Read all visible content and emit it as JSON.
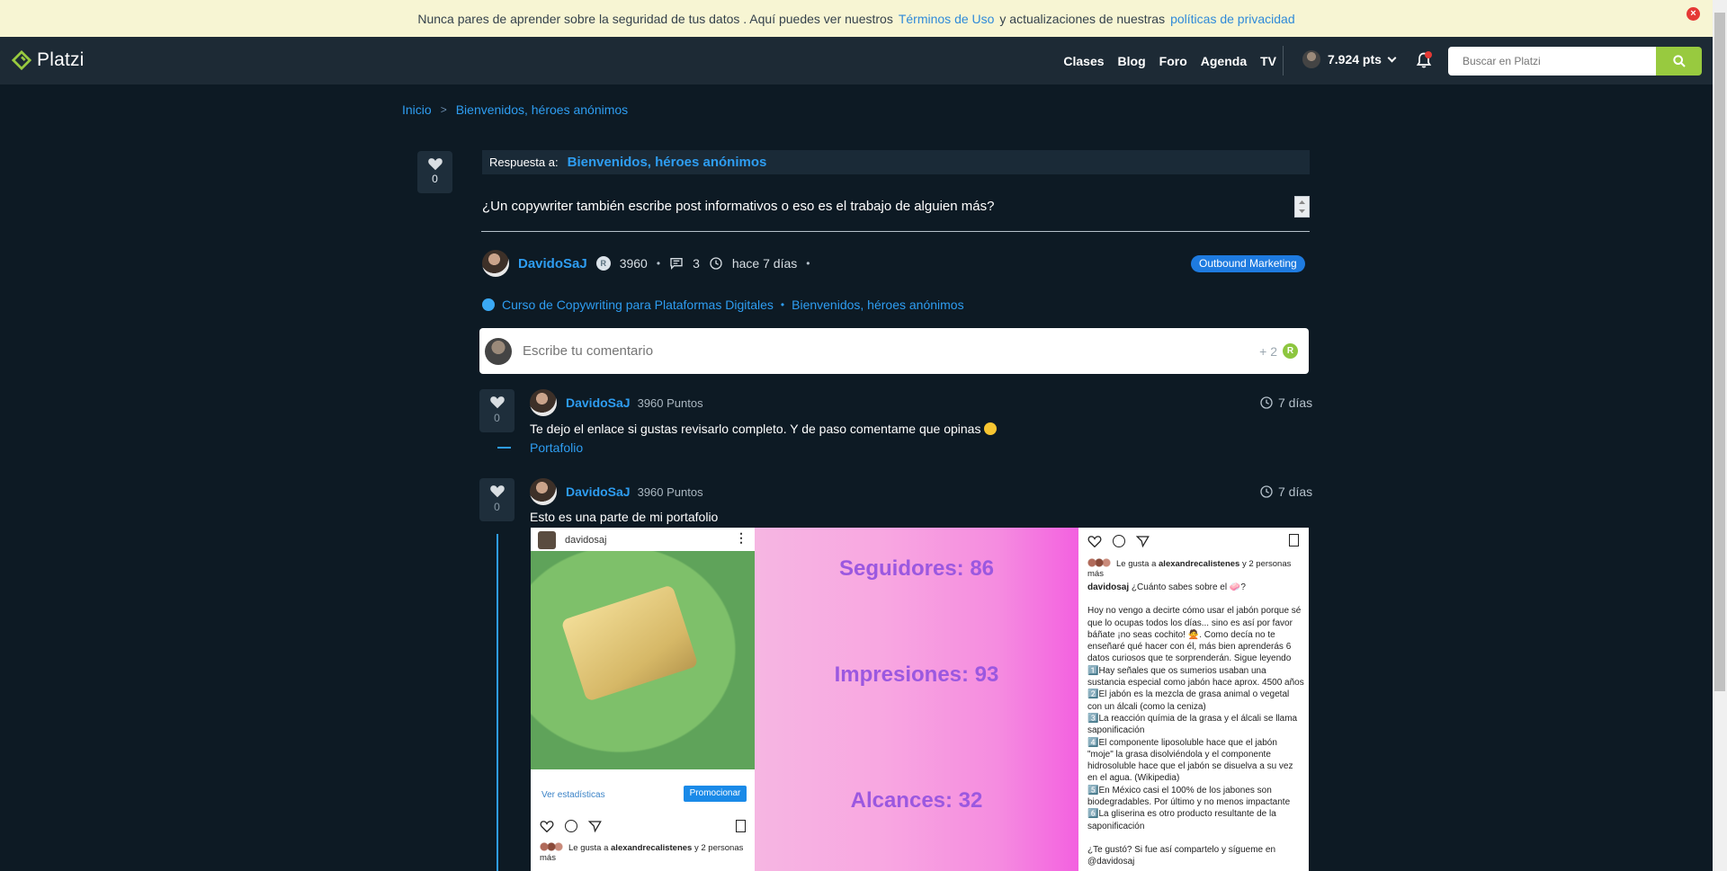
{
  "banner": {
    "text_before": "Nunca pares de aprender sobre la seguridad de tus datos . Aquí puedes ver nuestros",
    "terms_link": "Términos de Uso",
    "text_middle": "y actualizaciones de nuestras",
    "privacy_link": "políticas de privacidad",
    "close_glyph": "×"
  },
  "header": {
    "logo": "Platzi",
    "nav": [
      "Clases",
      "Blog",
      "Foro",
      "Agenda",
      "TV"
    ],
    "points": "7.924 pts",
    "search_placeholder": "Buscar en Platzi",
    "accent_color": "#98ca3f",
    "icons": [
      "bell-icon",
      "search-icon",
      "chevron-down-icon"
    ]
  },
  "breadcrumb": {
    "home": "Inicio",
    "separator": ">",
    "current": "Bienvenidos, héroes anónimos"
  },
  "question": {
    "likes": "0",
    "reply_prefix": "Respuesta a:",
    "reply_target": "Bienvenidos, héroes anónimos",
    "text": "¿Un copywriter también escribe post informativos o eso es el trabajo de alguien más?",
    "author": "DavidoSaJ",
    "rank_badge": "R",
    "author_points": "3960",
    "comments": "3",
    "time": "hace 7 días",
    "tag": "Outbound Marketing",
    "course": "Curso de Copywriting para Plataformas Digitales",
    "course_section": "Bienvenidos, héroes anónimos",
    "separator": "•"
  },
  "comment_box": {
    "placeholder": "Escribe tu comentario",
    "points_reward": "+ 2",
    "points_badge": "R"
  },
  "answers": [
    {
      "likes": "0",
      "author": "DavidoSaJ",
      "points": "3960 Puntos",
      "time": "7 días",
      "text": "Te dejo el enlace si gustas revisarlo completo. Y de paso comentame que opinas",
      "link": "Portafolio"
    },
    {
      "likes": "0",
      "author": "DavidoSaJ",
      "points": "3960 Puntos",
      "time": "7 días",
      "text": "Esto es una parte de mi portafolio"
    }
  ],
  "portfolio_image": {
    "left": {
      "username": "davidosaj",
      "more": "⋮",
      "stats_link": "Ver estadísticas",
      "promote": "Promocionar",
      "likes_prefix": "Le gusta a",
      "likes_user": "alexandrecalistenes",
      "likes_suffix": "y 2 personas más"
    },
    "middle": {
      "followers": "Seguidores: 86",
      "impressions": "Impresiones: 93",
      "reach": "Alcances: 32"
    },
    "right": {
      "likes_prefix": "Le gusta a",
      "likes_user": "alexandrecalistenes",
      "likes_suffix": "y 2 personas más",
      "caption_user": "davidosaj",
      "caption_lines": [
        "¿Cuánto sabes sobre el 🧼?",
        "",
        "Hoy no vengo a decirte cómo usar el jabón porque sé que lo ocupas todos los días... sino es así por favor báñate ¡no seas cochito! 🙅. Como decía no te enseñaré qué hacer con él, más bien aprenderás 6 datos curiosos que te sorprenderán. Sigue leyendo",
        "1️⃣Hay señales que os sumerios usaban una sustancia especial como jabón hace aprox. 4500 años",
        "2️⃣El jabón es la mezcla de grasa animal o vegetal con un álcali (como la ceniza)",
        "3️⃣La reacción químia de la grasa y el álcali se llama saponificación",
        "4️⃣El componente liposoluble hace que el jabón \"moje\" la grasa disolviéndola y el componente hidrosoluble hace que el jabón se disuelva a su vez en el agua. (Wikipedia)",
        "5️⃣En México casi el 100% de los jabones son biodegradables. Por último y no menos impactante",
        "6️⃣La gliserina es otro producto resultante de la saponificación",
        "",
        "¿Te gustó? Si fue así compartelo y sígueme en @davidosaj"
      ]
    }
  }
}
